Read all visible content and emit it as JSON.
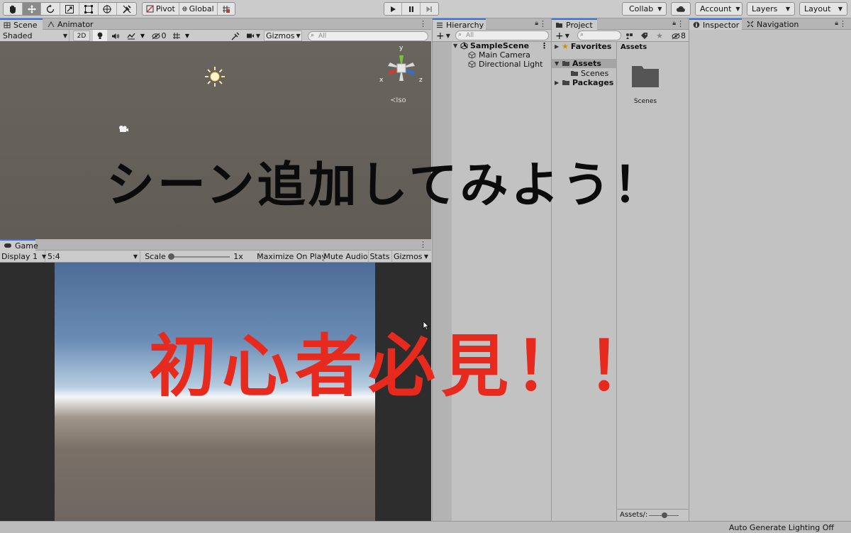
{
  "toolbar": {
    "pivot_label": "Pivot",
    "global_label": "Global",
    "collab_label": "Collab",
    "account_label": "Account",
    "layers_label": "Layers",
    "layout_label": "Layout"
  },
  "scene": {
    "tabs": [
      "Scene",
      "Animator"
    ],
    "shading_mode": "Shaded",
    "mode_2d": "2D",
    "hidden_count": "0",
    "gizmos_label": "Gizmos",
    "search_placeholder": "All",
    "axis_x": "x",
    "axis_y": "y",
    "axis_z": "z",
    "projection_label": "Iso"
  },
  "game": {
    "tab": "Game",
    "display": "Display 1",
    "aspect": "5:4",
    "scale_label": "Scale",
    "scale_value": "1x",
    "scale_fraction": 0.0,
    "maximize_label": "Maximize On Play",
    "mute_label": "Mute Audio",
    "stats_label": "Stats",
    "gizmos_label": "Gizmos"
  },
  "hierarchy": {
    "tab": "Hierarchy",
    "search_placeholder": "All",
    "scene_name": "SampleScene",
    "items": [
      "Main Camera",
      "Directional Light"
    ]
  },
  "project": {
    "tab": "Project",
    "hidden_count": "8",
    "favorites_label": "Favorites",
    "assets_label": "Assets",
    "scenes_label": "Scenes",
    "packages_label": "Packages",
    "breadcrumb": "Assets",
    "folder_name": "Scenes",
    "footer_path": "Assets/:"
  },
  "inspector": {
    "tabs": [
      "Inspector",
      "Navigation"
    ]
  },
  "status_bar": {
    "text": "Auto Generate Lighting Off"
  },
  "overlay": {
    "headline": "シーン追加してみよう！",
    "subheadline": "初心者必見！！"
  },
  "colors": {
    "accent": "#3a72d8",
    "overlay_red": "#e62b1e",
    "overlay_black": "#0b0b0b"
  }
}
